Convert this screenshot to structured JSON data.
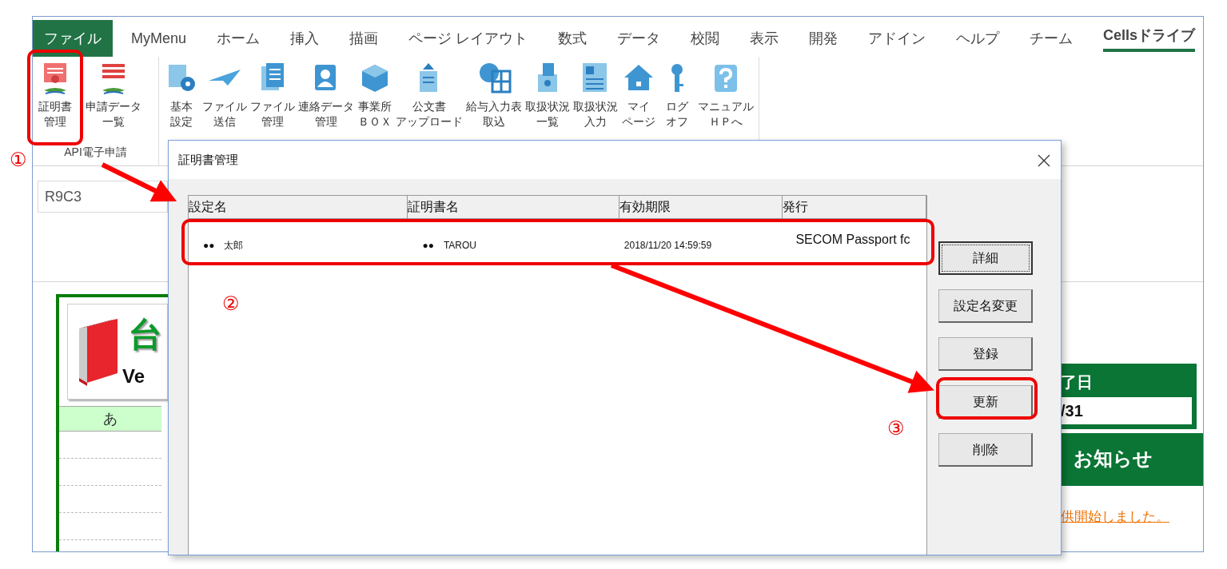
{
  "ribbon": {
    "tabs": [
      {
        "label": "ファイル",
        "kind": "file",
        "selected": false
      },
      {
        "label": "MyMenu",
        "kind": "tab",
        "selected": false
      },
      {
        "label": "ホーム",
        "kind": "tab",
        "selected": false
      },
      {
        "label": "挿入",
        "kind": "tab",
        "selected": false
      },
      {
        "label": "描画",
        "kind": "tab",
        "selected": false
      },
      {
        "label": "ページ レイアウト",
        "kind": "tab",
        "selected": false
      },
      {
        "label": "数式",
        "kind": "tab",
        "selected": false
      },
      {
        "label": "データ",
        "kind": "tab",
        "selected": false
      },
      {
        "label": "校閲",
        "kind": "tab",
        "selected": false
      },
      {
        "label": "表示",
        "kind": "tab",
        "selected": false
      },
      {
        "label": "開発",
        "kind": "tab",
        "selected": false
      },
      {
        "label": "アドイン",
        "kind": "tab",
        "selected": false
      },
      {
        "label": "ヘルプ",
        "kind": "tab",
        "selected": false
      },
      {
        "label": "チーム",
        "kind": "tab",
        "selected": false
      },
      {
        "label": "Cellsドライブ",
        "kind": "tab",
        "selected": true
      }
    ],
    "groups": [
      {
        "label": "API電子申請",
        "buttons": [
          {
            "lines": [
              "証明書",
              "管理"
            ]
          },
          {
            "lines": [
              "申請データ",
              "一覧"
            ]
          }
        ]
      },
      {
        "buttons": [
          {
            "lines": [
              "基本",
              "設定"
            ]
          },
          {
            "lines": [
              "ファイル",
              "送信"
            ]
          },
          {
            "lines": [
              "ファイル",
              "管理"
            ]
          },
          {
            "lines": [
              "連絡データ",
              "管理"
            ]
          },
          {
            "lines": [
              "事業所",
              "ＢＯＸ"
            ]
          },
          {
            "lines": [
              "公文書",
              "アップロード"
            ]
          },
          {
            "lines": [
              "給与入力表",
              "取込"
            ]
          },
          {
            "lines": [
              "取扱状況",
              "一覧"
            ]
          },
          {
            "lines": [
              "取扱状況",
              "入力"
            ]
          },
          {
            "lines": [
              "マイ",
              "ページ"
            ]
          },
          {
            "lines": [
              "ログ",
              "オフ"
            ]
          },
          {
            "lines": [
              "マニュアル",
              "ＨＰへ"
            ]
          }
        ]
      }
    ]
  },
  "name_box": "R9C3",
  "sheet": {
    "title_partial": "台",
    "version_partial": "Ve",
    "column_header": "あ",
    "end_date_label": "了日",
    "end_date_value": "/31",
    "notice_title": "お知らせ",
    "notice_link": "供開始しました。"
  },
  "dialog": {
    "title": "証明書管理",
    "columns": [
      "設定名",
      "証明書名",
      "有効期限",
      "発行"
    ],
    "rows": [
      {
        "cells": [
          "●●　太郎",
          "●●　TAROU",
          "2018/11/20  14:59:59",
          "SECOM Passport fc"
        ]
      }
    ],
    "buttons": [
      {
        "label": "詳細",
        "focused": true
      },
      {
        "label": "設定名変更",
        "focused": false
      },
      {
        "label": "登録",
        "focused": false
      },
      {
        "label": "更新",
        "focused": false
      },
      {
        "label": "削除",
        "focused": false
      }
    ]
  },
  "annotations": {
    "step_numbers": [
      "①",
      "②",
      "③"
    ]
  }
}
